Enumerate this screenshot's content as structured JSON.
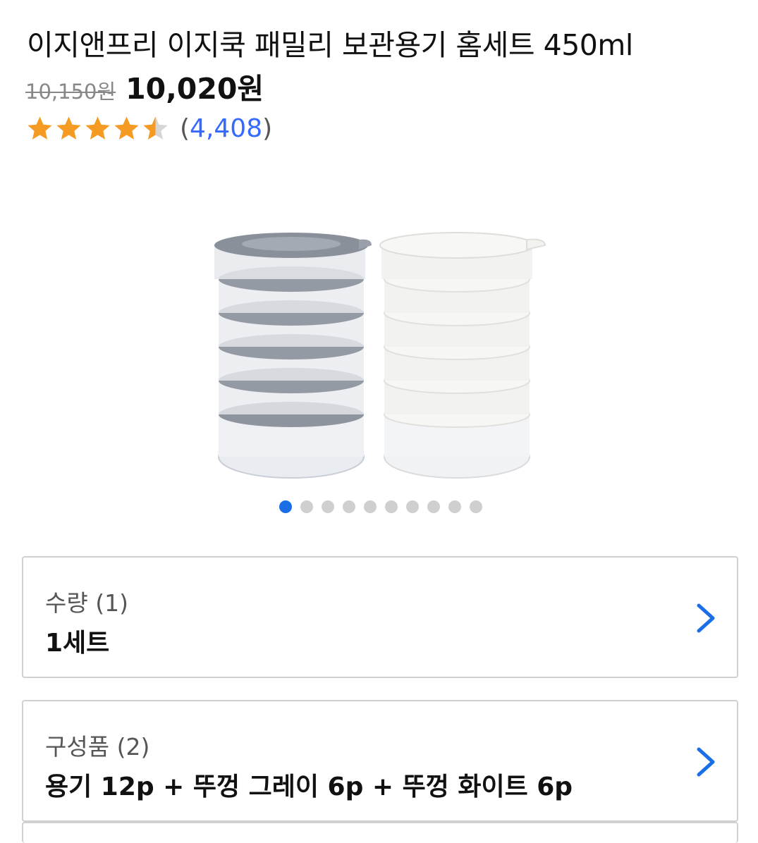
{
  "product": {
    "title": "이지앤프리 이지쿡 패밀리 보관용기 홈세트 450ml",
    "original_price": "10,150원",
    "sale_price": "10,020원",
    "rating": 4.5,
    "review_count_open": "(",
    "review_count": "4,408",
    "review_count_close": ")",
    "image_icon": "product-photo-containers"
  },
  "carousel": {
    "total": 10,
    "active_index": 0
  },
  "options": [
    {
      "label": "수량 (1)",
      "value": "1세트"
    },
    {
      "label": "구성품 (2)",
      "value": "용기 12p + 뚜껑 그레이 6p + 뚜껑 화이트 6p"
    }
  ],
  "colors": {
    "star": "#f59a23",
    "star_empty": "#d6d6d6",
    "link": "#346aff",
    "accent": "#1a6ee6"
  }
}
